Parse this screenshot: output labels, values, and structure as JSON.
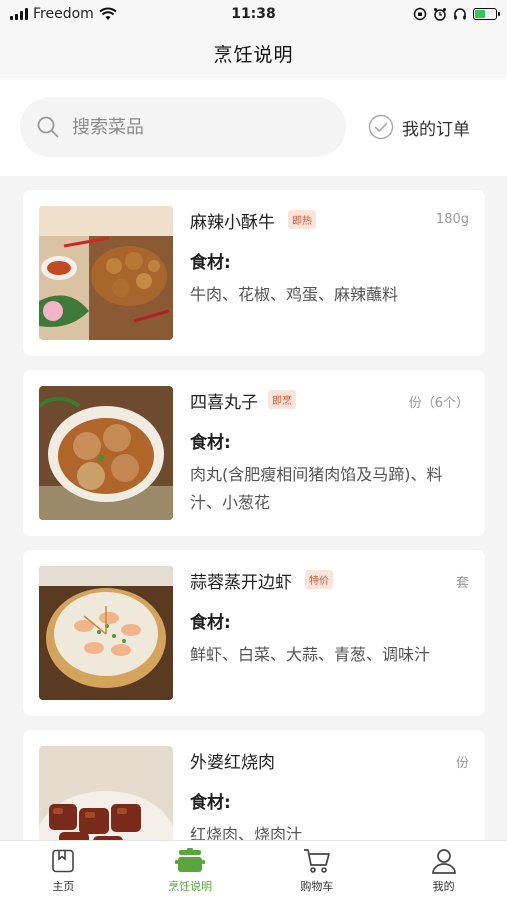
{
  "status_bar": {
    "carrier": "Freedom",
    "time": "11:38",
    "battery_level": 0.5
  },
  "nav": {
    "title": "烹饪说明"
  },
  "search": {
    "placeholder": "搜索菜品",
    "value": ""
  },
  "orders": {
    "label": "我的订单"
  },
  "dishes": [
    {
      "name": "麻辣小酥牛",
      "tag": "即热",
      "unit": "180g",
      "ingredients_label": "食材:",
      "ingredients": "牛肉、花椒、鸡蛋、麻辣蘸料"
    },
    {
      "name": "四喜丸子",
      "tag": "即烹",
      "unit": "份（6个）",
      "ingredients_label": "食材:",
      "ingredients": "肉丸(含肥瘦相间猪肉馅及马蹄)、料汁、小葱花"
    },
    {
      "name": "蒜蓉蒸开边虾",
      "tag": "特价",
      "unit": "套",
      "ingredients_label": "食材:",
      "ingredients": "鲜虾、白菜、大蒜、青葱、调味汁"
    },
    {
      "name": "外婆红烧肉",
      "tag": "",
      "unit": "份",
      "ingredients_label": "食材:",
      "ingredients": "红烧肉、烧肉汁"
    }
  ],
  "tabs": [
    {
      "label": "主页",
      "icon": "home-icon"
    },
    {
      "label": "烹饪说明",
      "icon": "pot-icon",
      "active": true
    },
    {
      "label": "购物车",
      "icon": "cart-icon"
    },
    {
      "label": "我的",
      "icon": "user-icon"
    }
  ],
  "colors": {
    "accent_green": "#5aa63a",
    "tag_bg": "#fde4db",
    "tag_text": "#d9583a"
  }
}
